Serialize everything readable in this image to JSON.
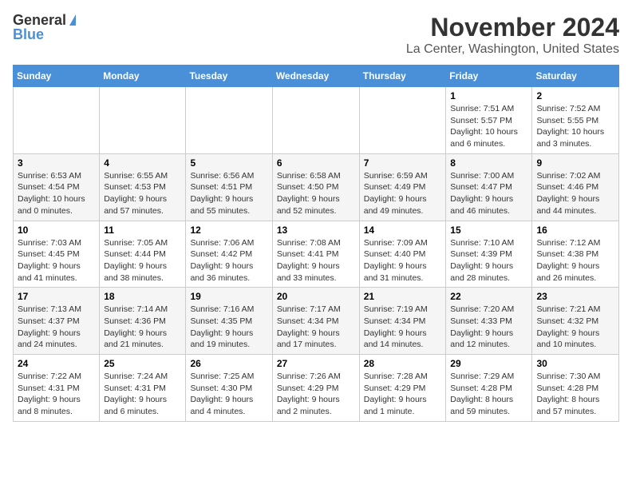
{
  "header": {
    "logo_general": "General",
    "logo_blue": "Blue",
    "month_title": "November 2024",
    "location": "La Center, Washington, United States"
  },
  "days_of_week": [
    "Sunday",
    "Monday",
    "Tuesday",
    "Wednesday",
    "Thursday",
    "Friday",
    "Saturday"
  ],
  "weeks": [
    [
      {
        "day": "",
        "info": ""
      },
      {
        "day": "",
        "info": ""
      },
      {
        "day": "",
        "info": ""
      },
      {
        "day": "",
        "info": ""
      },
      {
        "day": "",
        "info": ""
      },
      {
        "day": "1",
        "info": "Sunrise: 7:51 AM\nSunset: 5:57 PM\nDaylight: 10 hours and 6 minutes."
      },
      {
        "day": "2",
        "info": "Sunrise: 7:52 AM\nSunset: 5:55 PM\nDaylight: 10 hours and 3 minutes."
      }
    ],
    [
      {
        "day": "3",
        "info": "Sunrise: 6:53 AM\nSunset: 4:54 PM\nDaylight: 10 hours and 0 minutes."
      },
      {
        "day": "4",
        "info": "Sunrise: 6:55 AM\nSunset: 4:53 PM\nDaylight: 9 hours and 57 minutes."
      },
      {
        "day": "5",
        "info": "Sunrise: 6:56 AM\nSunset: 4:51 PM\nDaylight: 9 hours and 55 minutes."
      },
      {
        "day": "6",
        "info": "Sunrise: 6:58 AM\nSunset: 4:50 PM\nDaylight: 9 hours and 52 minutes."
      },
      {
        "day": "7",
        "info": "Sunrise: 6:59 AM\nSunset: 4:49 PM\nDaylight: 9 hours and 49 minutes."
      },
      {
        "day": "8",
        "info": "Sunrise: 7:00 AM\nSunset: 4:47 PM\nDaylight: 9 hours and 46 minutes."
      },
      {
        "day": "9",
        "info": "Sunrise: 7:02 AM\nSunset: 4:46 PM\nDaylight: 9 hours and 44 minutes."
      }
    ],
    [
      {
        "day": "10",
        "info": "Sunrise: 7:03 AM\nSunset: 4:45 PM\nDaylight: 9 hours and 41 minutes."
      },
      {
        "day": "11",
        "info": "Sunrise: 7:05 AM\nSunset: 4:44 PM\nDaylight: 9 hours and 38 minutes."
      },
      {
        "day": "12",
        "info": "Sunrise: 7:06 AM\nSunset: 4:42 PM\nDaylight: 9 hours and 36 minutes."
      },
      {
        "day": "13",
        "info": "Sunrise: 7:08 AM\nSunset: 4:41 PM\nDaylight: 9 hours and 33 minutes."
      },
      {
        "day": "14",
        "info": "Sunrise: 7:09 AM\nSunset: 4:40 PM\nDaylight: 9 hours and 31 minutes."
      },
      {
        "day": "15",
        "info": "Sunrise: 7:10 AM\nSunset: 4:39 PM\nDaylight: 9 hours and 28 minutes."
      },
      {
        "day": "16",
        "info": "Sunrise: 7:12 AM\nSunset: 4:38 PM\nDaylight: 9 hours and 26 minutes."
      }
    ],
    [
      {
        "day": "17",
        "info": "Sunrise: 7:13 AM\nSunset: 4:37 PM\nDaylight: 9 hours and 24 minutes."
      },
      {
        "day": "18",
        "info": "Sunrise: 7:14 AM\nSunset: 4:36 PM\nDaylight: 9 hours and 21 minutes."
      },
      {
        "day": "19",
        "info": "Sunrise: 7:16 AM\nSunset: 4:35 PM\nDaylight: 9 hours and 19 minutes."
      },
      {
        "day": "20",
        "info": "Sunrise: 7:17 AM\nSunset: 4:34 PM\nDaylight: 9 hours and 17 minutes."
      },
      {
        "day": "21",
        "info": "Sunrise: 7:19 AM\nSunset: 4:34 PM\nDaylight: 9 hours and 14 minutes."
      },
      {
        "day": "22",
        "info": "Sunrise: 7:20 AM\nSunset: 4:33 PM\nDaylight: 9 hours and 12 minutes."
      },
      {
        "day": "23",
        "info": "Sunrise: 7:21 AM\nSunset: 4:32 PM\nDaylight: 9 hours and 10 minutes."
      }
    ],
    [
      {
        "day": "24",
        "info": "Sunrise: 7:22 AM\nSunset: 4:31 PM\nDaylight: 9 hours and 8 minutes."
      },
      {
        "day": "25",
        "info": "Sunrise: 7:24 AM\nSunset: 4:31 PM\nDaylight: 9 hours and 6 minutes."
      },
      {
        "day": "26",
        "info": "Sunrise: 7:25 AM\nSunset: 4:30 PM\nDaylight: 9 hours and 4 minutes."
      },
      {
        "day": "27",
        "info": "Sunrise: 7:26 AM\nSunset: 4:29 PM\nDaylight: 9 hours and 2 minutes."
      },
      {
        "day": "28",
        "info": "Sunrise: 7:28 AM\nSunset: 4:29 PM\nDaylight: 9 hours and 1 minute."
      },
      {
        "day": "29",
        "info": "Sunrise: 7:29 AM\nSunset: 4:28 PM\nDaylight: 8 hours and 59 minutes."
      },
      {
        "day": "30",
        "info": "Sunrise: 7:30 AM\nSunset: 4:28 PM\nDaylight: 8 hours and 57 minutes."
      }
    ]
  ]
}
